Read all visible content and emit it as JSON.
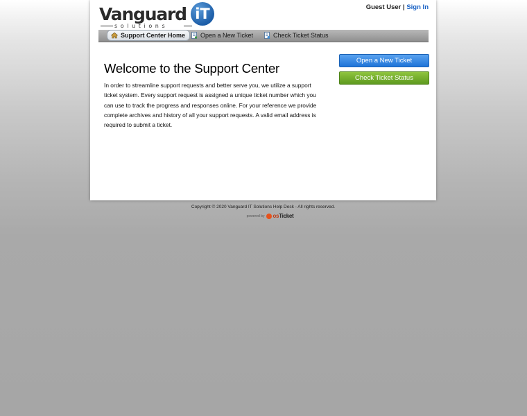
{
  "header": {
    "logo_word": "Vanguard",
    "logo_badge": "iT",
    "logo_sub": "solutions",
    "user_label": "Guest User",
    "separator": "|",
    "sign_in": "Sign In"
  },
  "nav": {
    "items": [
      {
        "label": "Support Center Home",
        "active": true
      },
      {
        "label": "Open a New Ticket",
        "active": false
      },
      {
        "label": "Check Ticket Status",
        "active": false
      }
    ]
  },
  "main": {
    "title": "Welcome to the Support Center",
    "intro": "In order to streamline support requests and better serve you, we utilize a support ticket system. Every support request is assigned a unique ticket number which you can use to track the progress and responses online. For your reference we provide complete archives and history of all your support requests. A valid email address is required to submit a ticket."
  },
  "sidebar": {
    "open_label": "Open a New Ticket",
    "check_label": "Check Ticket Status"
  },
  "footer": {
    "copyright": "Copyright © 2020 Vanguard IT Solutions Help Desk - All rights reserved.",
    "powered_by": "powered by",
    "brand_os": "os",
    "brand_ticket": "Ticket"
  },
  "colors": {
    "link": "#1a62c4",
    "open_button": "#2b7fdf",
    "check_button": "#6ea62a"
  }
}
